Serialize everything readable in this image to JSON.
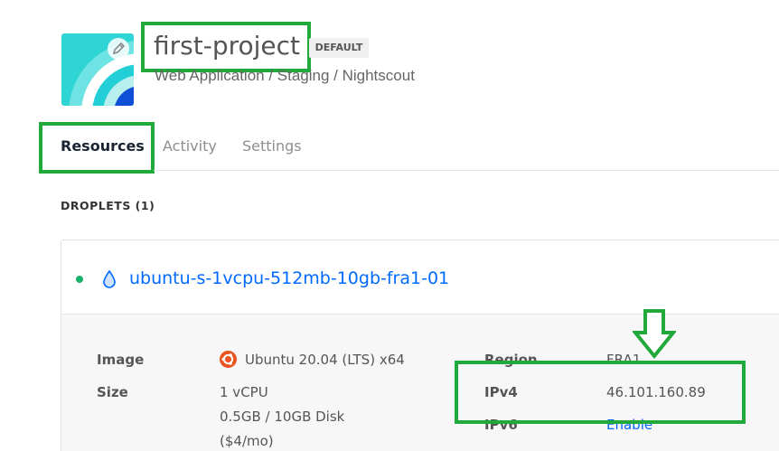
{
  "project": {
    "title": "first-project",
    "badge": "DEFAULT",
    "subtitle": "Web Application / Staging / Nightscout"
  },
  "tabs": [
    {
      "label": "Resources",
      "active": true
    },
    {
      "label": "Activity",
      "active": false
    },
    {
      "label": "Settings",
      "active": false
    }
  ],
  "droplets_heading": "DROPLETS (1)",
  "droplet": {
    "name": "ubuntu-s-1vcpu-512mb-10gb-fra1-01",
    "status": "active",
    "image_label": "Image",
    "image_value": "Ubuntu 20.04 (LTS) x64",
    "size_label": "Size",
    "size_lines": [
      "1 vCPU",
      "0.5GB / 10GB Disk",
      "($4/mo)"
    ],
    "region_label": "Region",
    "region_value": "FRA1",
    "ipv4_label": "IPv4",
    "ipv4_value": "46.101.160.89",
    "ipv6_label": "IPv6",
    "ipv6_value": "Enable"
  },
  "colors": {
    "accent_link": "#0069ff",
    "annotation_green": "#22a93b",
    "status_green": "#18b46b"
  },
  "icons": [
    "project-icon",
    "pencil-icon",
    "droplet-icon",
    "ubuntu-icon",
    "down-arrow-icon"
  ]
}
